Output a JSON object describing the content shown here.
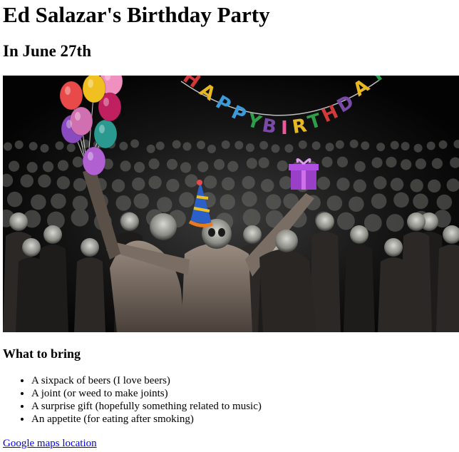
{
  "page": {
    "title": "Ed Salazar's Birthday Party",
    "subtitle": "In June 27th"
  },
  "banner": {
    "letters": [
      "H",
      "A",
      "P",
      "P",
      "Y",
      "B",
      "I",
      "R",
      "T",
      "H",
      "D",
      "A",
      "Y"
    ],
    "letter_colors": [
      "#d23a3a",
      "#e8b820",
      "#3a9bd8",
      "#3a9bd8",
      "#2e9e4a",
      "#7a4aa8",
      "#e85a9a",
      "#e8b820",
      "#2e9e4a",
      "#d23a3a",
      "#7a4aa8",
      "#e8b820",
      "#2e9e4a"
    ]
  },
  "balloons": {
    "colors": [
      "#e84a4a",
      "#f0c020",
      "#c02060",
      "#d070b0",
      "#2a9a90",
      "#8a4ac0",
      "#b060d0",
      "#f090c0"
    ]
  },
  "bring": {
    "heading": "What to bring",
    "items": [
      "A sixpack of beers (I love beers)",
      "A joint (or weed to make joints)",
      "A surprise gift (hopefully something related to music)",
      "An appetite (for eating after smoking)"
    ]
  },
  "link": {
    "text": "Google maps location"
  }
}
